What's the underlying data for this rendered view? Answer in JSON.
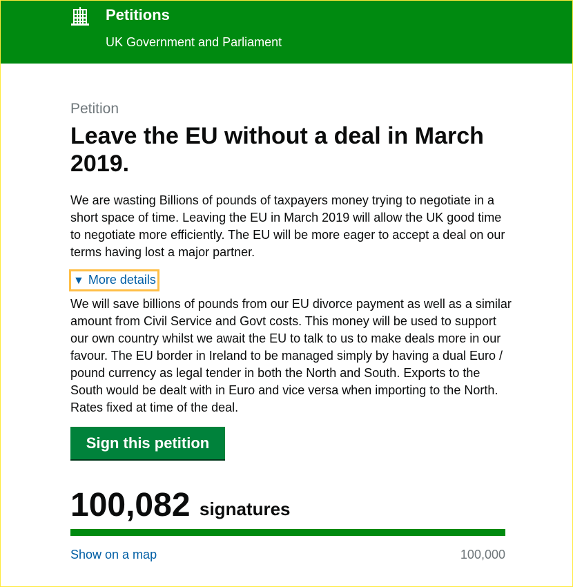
{
  "header": {
    "title": "Petitions",
    "subtitle": "UK Government and Parliament",
    "logo_icon": "portcullis-icon",
    "background_color": "#008a10"
  },
  "petition": {
    "kicker": "Petition",
    "title": "Leave the EU without a deal in March 2019.",
    "summary": "We are wasting Billions of pounds of taxpayers money trying to negotiate in a short space of time. Leaving the EU in March 2019 will allow the UK good time to negotiate more efficiently. The EU will be more eager to accept a deal on our terms having lost a major partner.",
    "more_details_label": "More details",
    "more_details_icon": "triangle-down-icon",
    "details": "We will save billions of pounds from our EU divorce payment as well as a similar amount from Civil Service and Govt costs. This money will be used to support our own country whilst we await the EU to talk to us to make deals more in our favour. The EU border in Ireland to be managed simply by having a dual Euro / pound currency as legal tender in both the North and South. Exports to the South would be dealt with in Euro and vice versa when importing to the North. Rates fixed at time of the deal."
  },
  "actions": {
    "sign_label": "Sign this petition",
    "sign_color": "#00823b"
  },
  "signatures": {
    "count": "100,082",
    "label": "signatures",
    "target": "100,000",
    "progress_fraction": 1.0,
    "map_link": "Show on a map"
  }
}
